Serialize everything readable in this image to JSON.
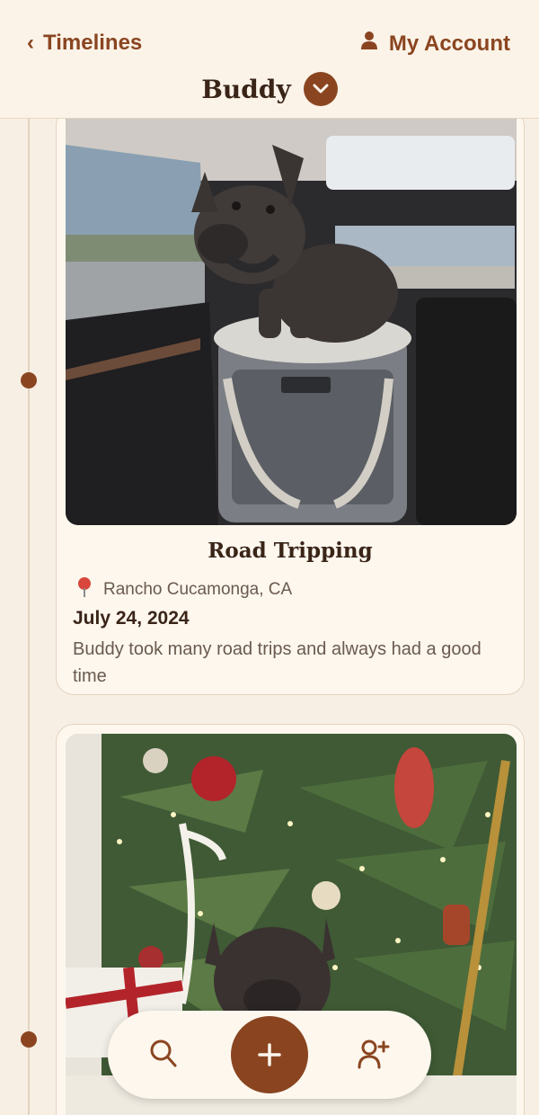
{
  "header": {
    "back_label": "Timelines",
    "account_label": "My Account",
    "title": "Buddy"
  },
  "entries": [
    {
      "title": "Road Tripping",
      "location": "Rancho Cucamonga, CA",
      "date": "July 24, 2024",
      "description": "Buddy took many road trips and always had a good time"
    }
  ],
  "icons": {
    "back": "chevron-left-icon",
    "account": "person-icon",
    "title_toggle": "chevron-down-icon",
    "location": "map-pin-icon",
    "search": "search-icon",
    "add": "plus-icon",
    "share": "add-user-icon"
  },
  "colors": {
    "accent": "#8a4520",
    "background": "#f8efe4",
    "card": "#fdf7ee",
    "text_dark": "#3a2418",
    "text_muted": "#6a5a4e",
    "location_pin": "#d9473c"
  }
}
